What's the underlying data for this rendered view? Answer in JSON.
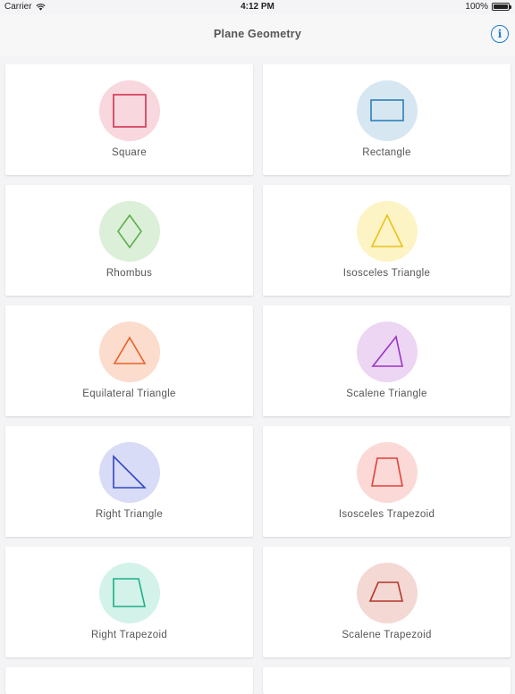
{
  "status_bar": {
    "carrier": "Carrier",
    "time": "4:12 PM",
    "battery": "100%"
  },
  "nav": {
    "title": "Plane Geometry",
    "info_icon": "info-icon"
  },
  "shapes": [
    {
      "label": "Square",
      "icon": "square-icon",
      "bg": "#f8d7de",
      "stroke": "#d0334f"
    },
    {
      "label": "Rectangle",
      "icon": "rectangle-icon",
      "bg": "#d7e7f2",
      "stroke": "#2c7fb8"
    },
    {
      "label": "Rhombus",
      "icon": "rhombus-icon",
      "bg": "#dcefd8",
      "stroke": "#5bb04a"
    },
    {
      "label": "Isosceles Triangle",
      "icon": "isosceles-triangle-icon",
      "bg": "#fdf4c5",
      "stroke": "#e8c21a"
    },
    {
      "label": "Equilateral Triangle",
      "icon": "equilateral-triangle-icon",
      "bg": "#fbdccd",
      "stroke": "#e8622a"
    },
    {
      "label": "Scalene Triangle",
      "icon": "scalene-triangle-icon",
      "bg": "#ecd6f4",
      "stroke": "#9c34c4"
    },
    {
      "label": "Right Triangle",
      "icon": "right-triangle-icon",
      "bg": "#d8dcf6",
      "stroke": "#3447c4"
    },
    {
      "label": "Isosceles Trapezoid",
      "icon": "isosceles-trapezoid-icon",
      "bg": "#fbd9d6",
      "stroke": "#e2413a"
    },
    {
      "label": "Right Trapezoid",
      "icon": "right-trapezoid-icon",
      "bg": "#d3f2ea",
      "stroke": "#1fae88"
    },
    {
      "label": "Scalene Trapezoid",
      "icon": "scalene-trapezoid-icon",
      "bg": "#f3d8d3",
      "stroke": "#b4362a"
    }
  ]
}
